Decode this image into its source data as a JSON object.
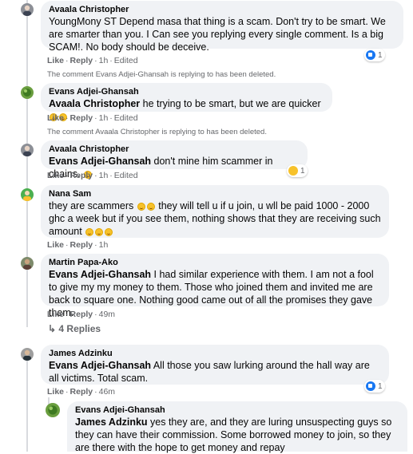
{
  "comments": [
    {
      "author": "Avaala Christopher",
      "mention": "",
      "text": "YoungMony ST Depend masa that thing is a scam. Don't try to be smart. We are smarter than you. I Can see you replying every single comment. Is a big SCAM!. No body should be deceive.",
      "actions": {
        "like": "Like",
        "reply": "Reply",
        "time": "1h",
        "edited": "Edited"
      },
      "reaction_count": "1"
    },
    {
      "author": "Evans Adjei-Ghansah",
      "mention": "Avaala Christopher",
      "text": "he trying to be smart, but we are quicker",
      "actions": {
        "like": "Like",
        "reply": "Reply",
        "time": "1h",
        "edited": "Edited"
      }
    },
    {
      "author": "Avaala Christopher",
      "mention": "Evans Adjei-Ghansah",
      "text": "don't mine him scammer in chains.",
      "actions": {
        "like": "Like",
        "reply": "Reply",
        "time": "1h",
        "edited": "Edited"
      },
      "reaction_count": "1"
    },
    {
      "author": "Nana Sam",
      "mention": "",
      "text_a": "they are scammers",
      "text_b": "they will tell u if u join, u wll be paid 1000 - 2000 ghc a week but if you see them, nothing shows that they are receiving such amount",
      "actions": {
        "like": "Like",
        "reply": "Reply",
        "time": "1h"
      }
    },
    {
      "author": "Martin Papa-Ako",
      "mention": "Evans Adjei-Ghansah",
      "text": "I had similar experience with them. I am not a fool to give my my money to them. Those who joined them and invited me are back to square one. Nothing good came out of all the promises they gave them.",
      "actions": {
        "like": "Like",
        "reply": "Reply",
        "time": "49m"
      }
    },
    {
      "author": "James Adzinku",
      "mention": "Evans Adjei-Ghansah",
      "text": "All those you saw lurking around the hall way are all victims. Total scam.",
      "actions": {
        "like": "Like",
        "reply": "Reply",
        "time": "46m"
      },
      "reaction_count": "1"
    },
    {
      "author": "Evans Adjei-Ghansah",
      "mention": "James Adzinku",
      "text": "yes they are, and they are luring unsuspecting guys so they can have their commission. Some borrowed money to join, so they are there with the hope to get money and repay"
    }
  ],
  "deleted_notices": [
    "The comment Evans Adjei-Ghansah is replying to has been deleted.",
    "The comment Avaala Christopher is replying to has been deleted."
  ],
  "view_replies": "4 Replies",
  "reply_arrow": "↳",
  "separator": "·",
  "colors": {
    "bubble": "#f0f2f5",
    "meta": "#65676b",
    "like_blue": "#1877f2"
  }
}
